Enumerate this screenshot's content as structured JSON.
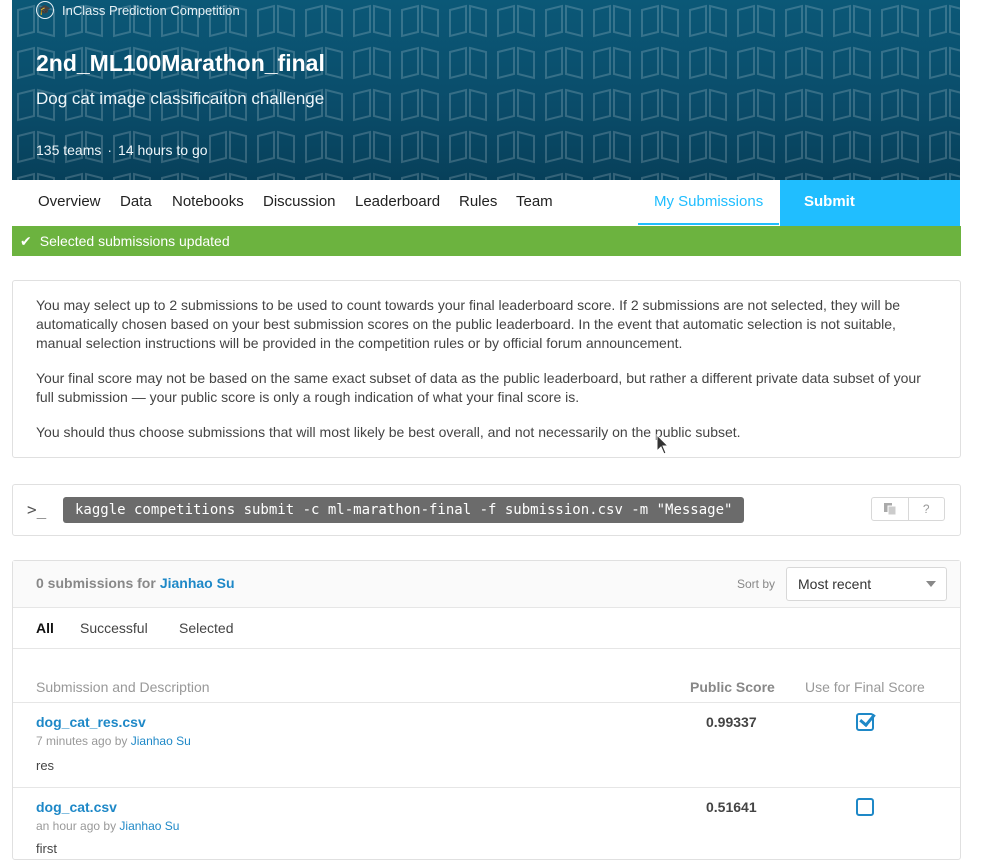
{
  "header": {
    "badge": "InClass Prediction Competition",
    "title": "2nd_ML100Marathon_final",
    "subtitle": "Dog cat image classificaiton challenge",
    "teams": "135 teams",
    "separator": "·",
    "time_left": "14 hours to go",
    "accent_color": "#0a4d6b"
  },
  "tabs": {
    "overview": "Overview",
    "data": "Data",
    "notebooks": "Notebooks",
    "discussion": "Discussion",
    "leaderboard": "Leaderboard",
    "rules": "Rules",
    "team": "Team",
    "my_submissions": "My Submissions",
    "submit_predictions": "Submit Predictions"
  },
  "notice": {
    "text": "Selected submissions updated",
    "color": "#6cb33f"
  },
  "info": {
    "p1": "You may select up to 2 submissions to be used to count towards your final leaderboard score. If 2 submissions are not selected, they will be automatically chosen based on your best submission scores on the public leaderboard. In the event that automatic selection is not suitable, manual selection instructions will be provided in the competition rules or by official forum announcement.",
    "p2": "Your final score may not be based on the same exact subset of data as the public leaderboard, but rather a different private data subset of your full submission — your public score is only a rough indication of what your final score is.",
    "p3": "You should thus choose submissions that will most likely be best overall, and not necessarily on the public subset."
  },
  "api": {
    "prompt": ">_",
    "command": "kaggle competitions submit -c ml-marathon-final -f submission.csv -m \"Message\"",
    "help": "?"
  },
  "submissions": {
    "count_text": "0 submissions for",
    "user": "Jianhao Su",
    "sort_label": "Sort by",
    "sort_value": "Most recent",
    "filters": [
      "All",
      "Successful",
      "Selected"
    ],
    "columns": {
      "description": "Submission and Description",
      "score": "Public Score",
      "final": "Use for Final Score"
    },
    "rows": [
      {
        "name": "dog_cat_res.csv",
        "time": "7 minutes ago by",
        "user": "Jianhao Su",
        "description": "res",
        "score": "0.99337",
        "selected": true
      },
      {
        "name": "dog_cat.csv",
        "time": "an hour ago by",
        "user": "Jianhao Su",
        "description": "first",
        "score": "0.51641",
        "selected": false
      }
    ]
  }
}
